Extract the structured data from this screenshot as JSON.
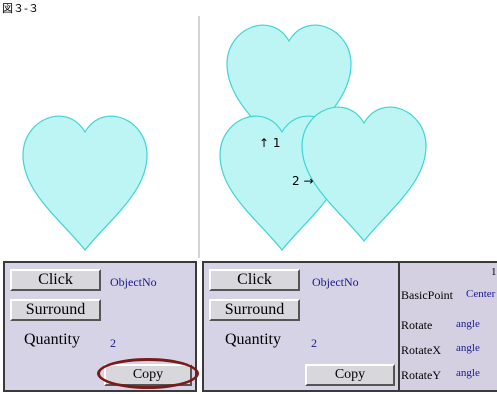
{
  "figure_title": "図３-３",
  "annotations": {
    "arrow_up": "↑ 1",
    "arrow_right": "2 →"
  },
  "left_panel": {
    "click_label": "Click",
    "surround_label": "Surround",
    "quantity_label": "Quantity",
    "object_no": "ObjectNo",
    "quantity_value": "2",
    "copy_label": "Copy"
  },
  "right_panel": {
    "click_label": "Click",
    "surround_label": "Surround",
    "quantity_label": "Quantity",
    "object_no": "ObjectNo",
    "quantity_value": "2",
    "copy_label": "Copy"
  },
  "properties": {
    "basic_point_label": "BasicPoint",
    "basic_point_value": "Center",
    "rotate_label": "Rotate",
    "rotate_value": "angle",
    "rotatex_label": "RotateX",
    "rotatex_value": "angle",
    "rotatey_label": "RotateY",
    "rotatey_value": "angle",
    "top_partial": "1"
  },
  "colors": {
    "heart_fill": "#bdf5f5",
    "heart_stroke": "#3fd4d4",
    "panel_bg": "#d6d3e6",
    "value_text": "#1a1a8c",
    "highlight_ring": "#7a1a1a"
  },
  "icons": {
    "heart": "heart-shape"
  }
}
